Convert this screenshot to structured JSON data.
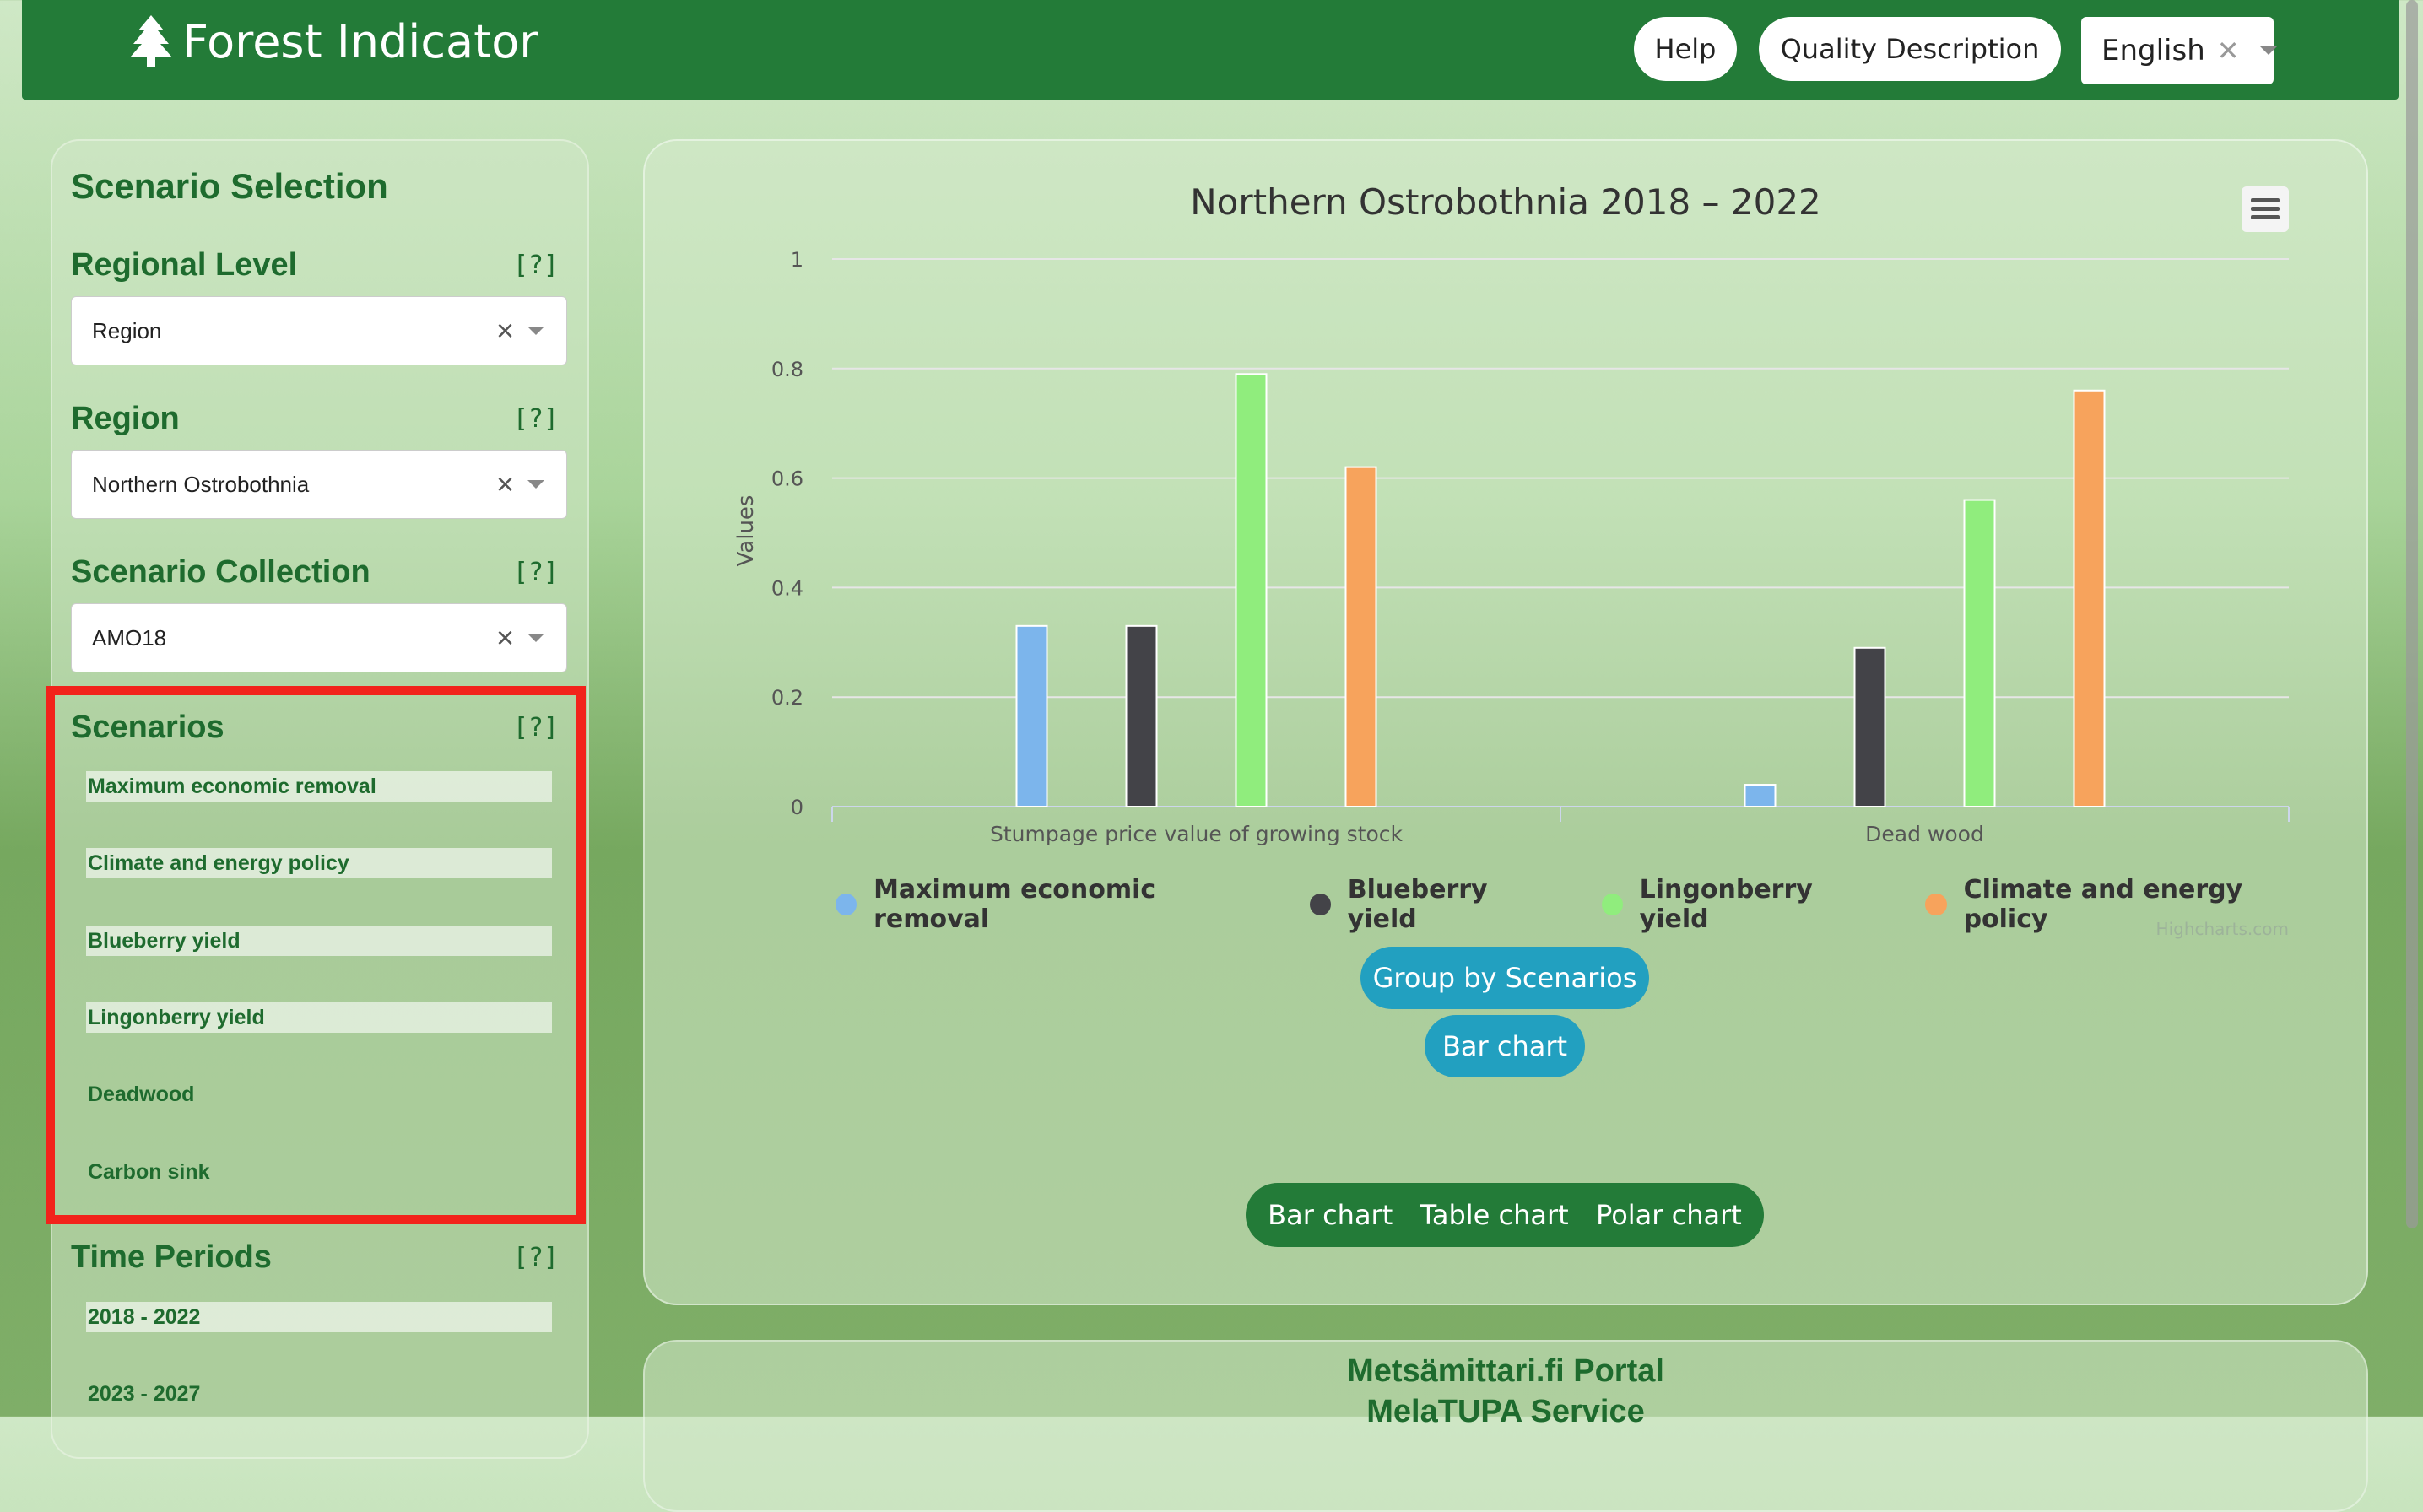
{
  "header": {
    "app_title": "Forest Indicator",
    "help_label": "Help",
    "quality_label": "Quality Description",
    "language_value": "English"
  },
  "sidebar": {
    "title": "Scenario Selection",
    "help_marker": "[?]",
    "regional_level": {
      "label": "Regional Level",
      "value": "Region"
    },
    "region": {
      "label": "Region",
      "value": "Northern Ostrobothnia"
    },
    "scenario_collection": {
      "label": "Scenario Collection",
      "value": "AMO18"
    },
    "scenarios": {
      "label": "Scenarios",
      "items": [
        {
          "label": "Maximum economic removal",
          "selected": true
        },
        {
          "label": "Climate and energy policy",
          "selected": true
        },
        {
          "label": "Blueberry yield",
          "selected": true
        },
        {
          "label": "Lingonberry yield",
          "selected": true
        },
        {
          "label": "Deadwood",
          "selected": false
        },
        {
          "label": "Carbon sink",
          "selected": false
        }
      ]
    },
    "time_periods": {
      "label": "Time Periods",
      "items": [
        {
          "label": "2018 - 2022",
          "selected": true
        },
        {
          "label": "2023 - 2027",
          "selected": false
        }
      ]
    }
  },
  "chart_panel": {
    "group_button": "Group by Scenarios",
    "type_button": "Bar chart",
    "tabs": [
      "Bar chart",
      "Table chart",
      "Polar chart"
    ],
    "credits": "Highcharts.com"
  },
  "chart_data": {
    "type": "bar",
    "title": "Northern Ostrobothnia 2018 – 2022",
    "ylabel": "Values",
    "ylim": [
      0,
      1
    ],
    "yticks": [
      "0",
      "0.2",
      "0.4",
      "0.6",
      "0.8",
      "1"
    ],
    "categories": [
      "Stumpage price value of growing stock",
      "Dead wood"
    ],
    "series": [
      {
        "name": "Maximum economic removal",
        "color": "#7cb5ec",
        "values": [
          0.33,
          0.04
        ]
      },
      {
        "name": "Blueberry yield",
        "color": "#434348",
        "values": [
          0.33,
          0.29
        ]
      },
      {
        "name": "Lingonberry yield",
        "color": "#90ed7d",
        "values": [
          0.79,
          0.56
        ]
      },
      {
        "name": "Climate and energy policy",
        "color": "#f7a35c",
        "values": [
          0.62,
          0.76
        ]
      }
    ]
  },
  "footer_panel": {
    "line1": "Metsämittari.fi Portal",
    "line2": "MelaTUPA Service"
  }
}
